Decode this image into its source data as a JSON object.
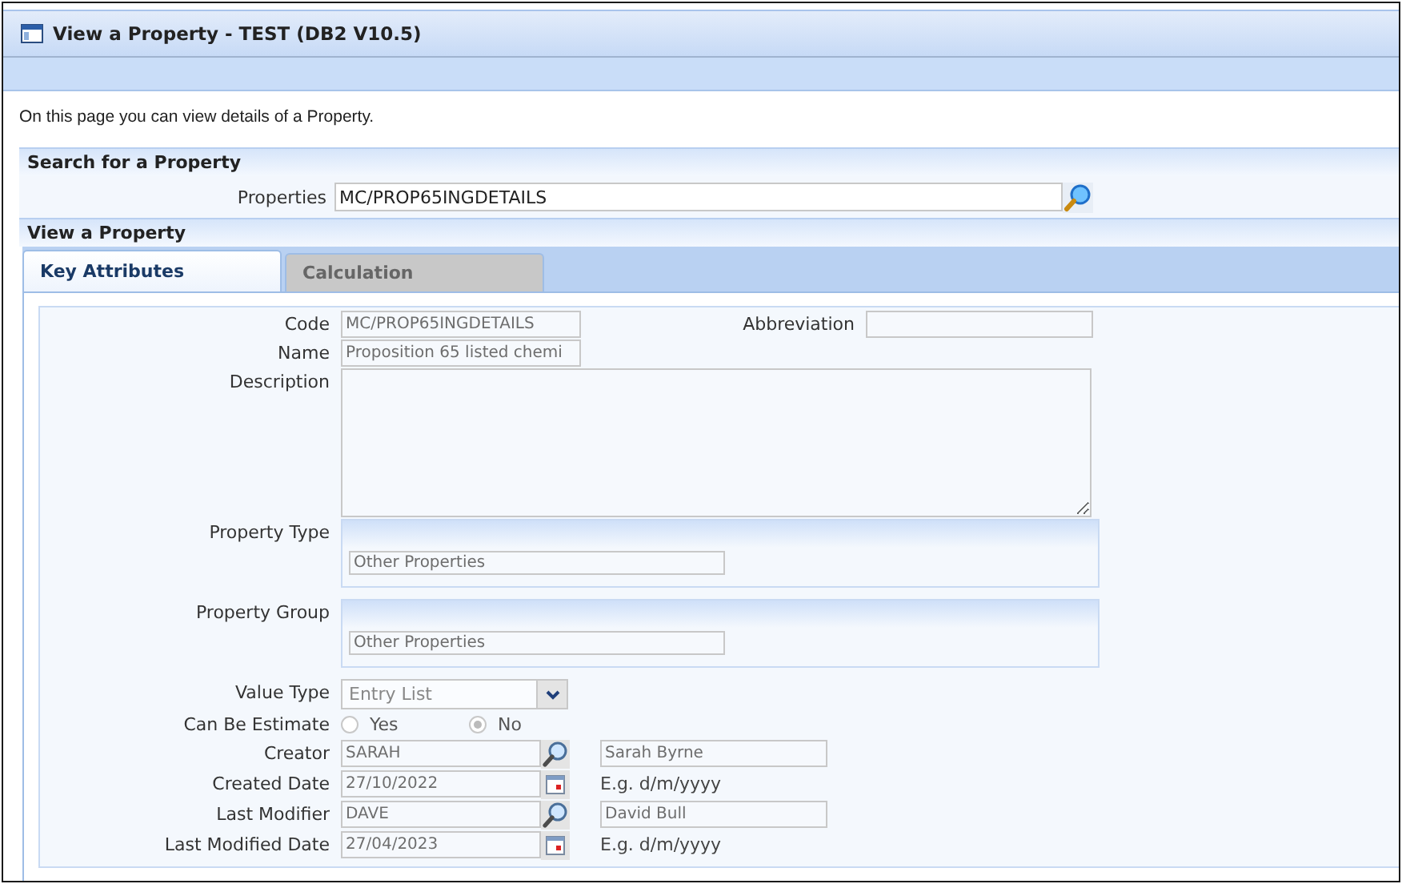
{
  "window": {
    "title": "View a Property - TEST (DB2 V10.5)"
  },
  "intro": "On this page you can view details of a Property.",
  "search_section": {
    "title": "Search for a Property",
    "field": {
      "label": "Properties",
      "value": "MC/PROP65INGDETAILS"
    }
  },
  "view_section": {
    "title": "View a Property"
  },
  "tabs": [
    {
      "label": "Key Attributes",
      "selected": true
    },
    {
      "label": "Calculation",
      "selected": false
    }
  ],
  "form": [
    {
      "kind": "text",
      "label": "Code",
      "value": "MC/PROP65INGDETAILS",
      "aside_label": "Abbreviation"
    },
    {
      "kind": "text",
      "label": "Name",
      "value": "Proposition 65 listed chemi"
    },
    {
      "kind": "textarea",
      "label": "Description"
    },
    {
      "kind": "group",
      "label": "Property Type",
      "value": "Other Properties"
    },
    {
      "kind": "group",
      "label": "Property Group",
      "value": "Other Properties"
    },
    {
      "kind": "select",
      "label": "Value Type",
      "value": "Entry List"
    },
    {
      "kind": "radio",
      "label": "Can Be Estimate",
      "options": [
        {
          "label": "Yes",
          "selected": false
        },
        {
          "label": "No",
          "selected": true
        }
      ]
    },
    {
      "kind": "lookup",
      "label": "Creator",
      "value": "SARAH",
      "display": "Sarah Byrne"
    },
    {
      "kind": "date",
      "label": "Created Date",
      "value": "27/10/2022",
      "hint": "E.g. d/m/yyyy"
    },
    {
      "kind": "lookup",
      "label": "Last Modifier",
      "value": "DAVE",
      "display": "David Bull"
    },
    {
      "kind": "date",
      "label": "Last Modified Date",
      "value": "27/04/2023",
      "hint": "E.g. d/m/yyyy"
    }
  ]
}
